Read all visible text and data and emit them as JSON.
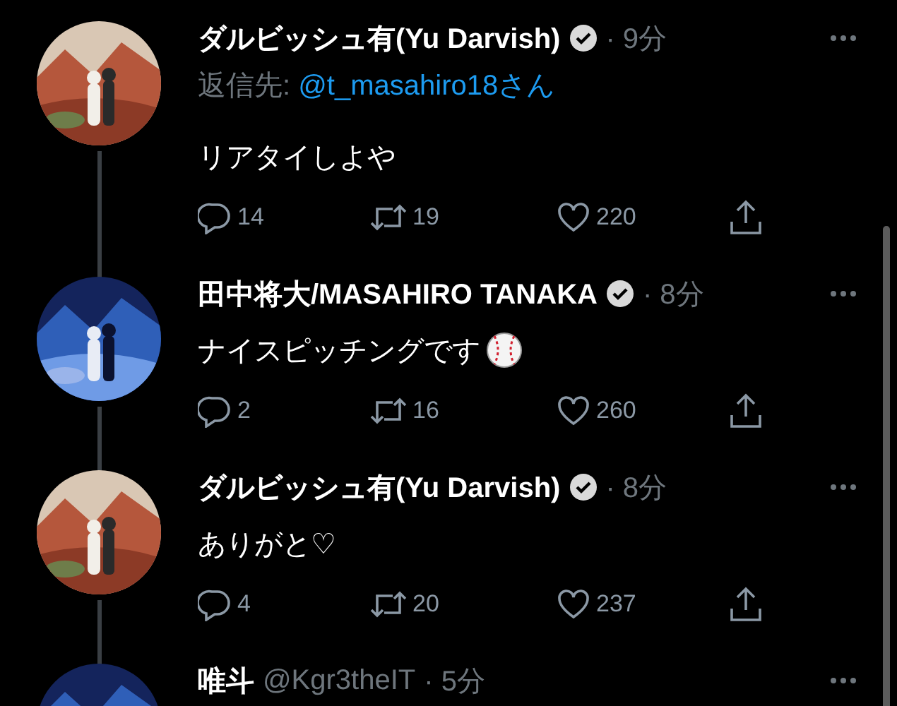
{
  "tweets": [
    {
      "name": "ダルビッシュ有(Yu Darvish)",
      "verified": true,
      "time": "· 9分",
      "reply_label": "返信先: ",
      "reply_to": "@t_masahiro18さん",
      "kind": "text",
      "text": "リアタイしよや",
      "counts": {
        "reply": "14",
        "retweet": "19",
        "like": "220"
      }
    },
    {
      "name": "田中将大/MASAHIRO TANAKA",
      "verified": true,
      "time": "· 8分",
      "kind": "text_with_icon",
      "text": "ナイスピッチングです",
      "counts": {
        "reply": "2",
        "retweet": "16",
        "like": "260"
      }
    },
    {
      "name": "ダルビッシュ有(Yu Darvish)",
      "verified": true,
      "time": "· 8分",
      "kind": "text",
      "text": "ありがと♡",
      "counts": {
        "reply": "4",
        "retweet": "20",
        "like": "237"
      }
    },
    {
      "name": "唯斗",
      "handle": "@Kgr3theIT",
      "time": "· 5分"
    }
  ]
}
